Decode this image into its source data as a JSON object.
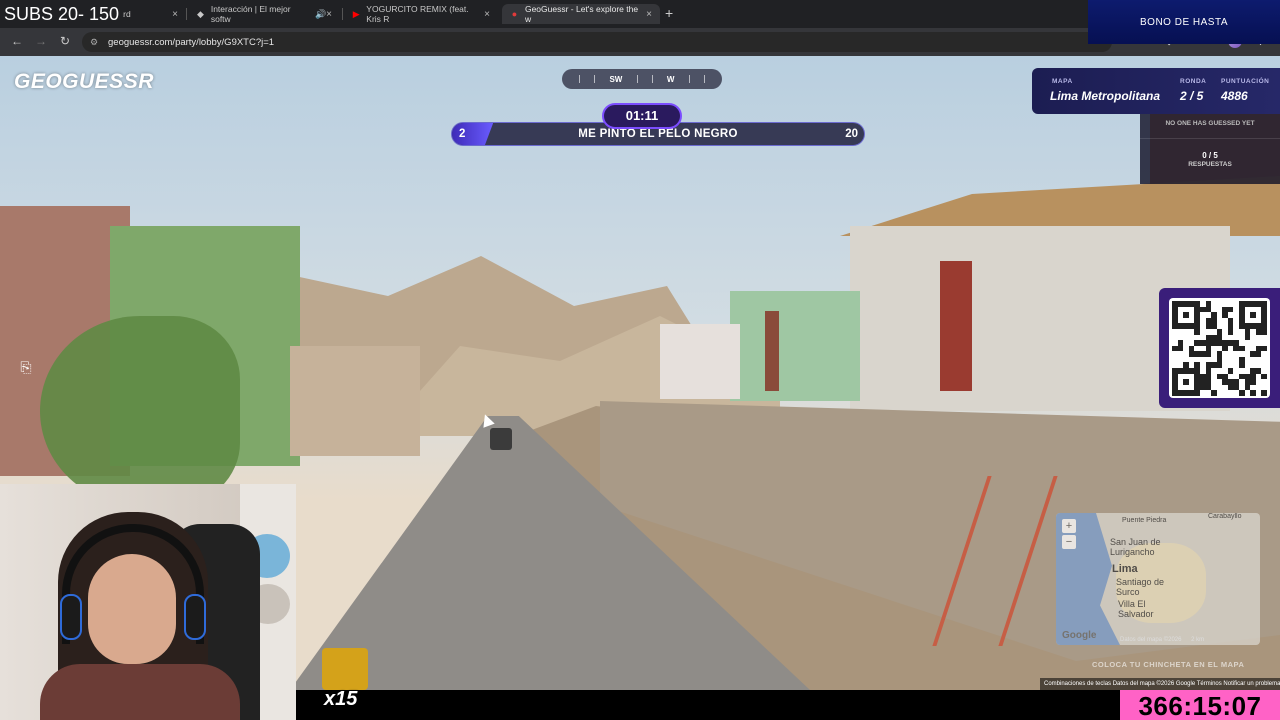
{
  "overlay": {
    "subs_text": "SUBS 20- 150",
    "bono_text": "BONO DE HASTA",
    "clock": "366:15:07",
    "streak": "x15"
  },
  "browser": {
    "tabs": [
      {
        "label": "board",
        "icon": "dashboard-icon"
      },
      {
        "label": "Interacción | El mejor softw",
        "icon": "diamond-icon",
        "audio": true
      },
      {
        "label": "YOGURCITO REMIX (feat. Kris R",
        "icon": "youtube-icon"
      },
      {
        "label": "GeoGuessr - Let's explore the w",
        "icon": "map-pin-icon",
        "active": true
      }
    ],
    "url": "geoguessr.com/party/lobby/G9XTC?j=1"
  },
  "game": {
    "logo": "GEOGUESSR",
    "compass": {
      "left": "SW",
      "right": "W"
    },
    "timer": "01:11",
    "progress": {
      "start": "2",
      "end": "20",
      "label": "ME PINTO EL PELO NEGRO",
      "fill_fraction": 0.1
    },
    "stats": {
      "map_label": "MAPA",
      "map_value": "Lima Metropolitana",
      "round_label": "RONDA",
      "round_value": "2 / 5",
      "score_label": "PUNTUACIÓN",
      "score_value": "4886"
    },
    "guesses": {
      "message": "NO ONE HAS GUESSED YET",
      "count": "0 / 5",
      "responses_label": "RESPUESTAS"
    },
    "minimap": {
      "labels": [
        "Puente Piedra",
        "Carabayllo",
        "San Juan de Lurigancho",
        "Lima",
        "Santiago de Surco",
        "Villa El Salvador"
      ],
      "zoom_in": "+",
      "zoom_out": "−",
      "google": "Google",
      "footer_mid": "Datos del mapa ©2026",
      "footer_km": "2 km",
      "guess_hint": "COLOCA TU CHINCHETA EN EL MAPA",
      "footer": "Combinaciones de teclas   Datos del mapa ©2026 Google   Términos   Notificar un problema"
    }
  },
  "colors": {
    "accent_purple": "#7c4dff",
    "clock_pink": "#ff62c6",
    "geoguessr_red": "#e23a3a"
  }
}
